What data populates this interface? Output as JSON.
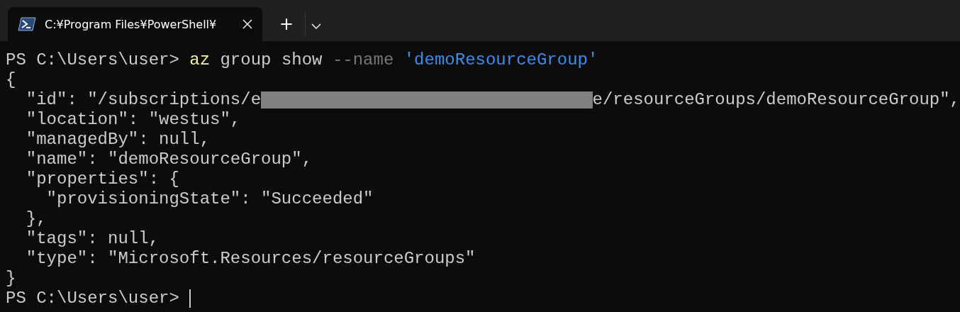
{
  "tabs": [
    {
      "title": "C:¥Program Files¥PowerShell¥",
      "selected": true
    }
  ],
  "new_tab": "+",
  "lines": [
    {
      "segments": [
        {
          "kind": "text",
          "text": "PS C:\\Users\\user> "
        },
        {
          "kind": "command",
          "text": "az"
        },
        {
          "kind": "text",
          "text": " group show "
        },
        {
          "kind": "parameter",
          "text": "--name"
        },
        {
          "kind": "string",
          "text": " 'demoResourceGroup'"
        }
      ]
    },
    {
      "segments": [
        {
          "kind": "text",
          "text": "{"
        }
      ]
    },
    {
      "segments": [
        {
          "kind": "text",
          "text": "  \"id\": \"/subscriptions/e"
        },
        {
          "kind": "redacted"
        },
        {
          "kind": "text",
          "text": "e/resourceGroups/demoResourceGroup\","
        }
      ]
    },
    {
      "segments": [
        {
          "kind": "text",
          "text": "  \"location\": \"westus\","
        }
      ]
    },
    {
      "segments": [
        {
          "kind": "text",
          "text": "  \"managedBy\": null,"
        }
      ]
    },
    {
      "segments": [
        {
          "kind": "text",
          "text": "  \"name\": \"demoResourceGroup\","
        }
      ]
    },
    {
      "segments": [
        {
          "kind": "text",
          "text": "  \"properties\": {"
        }
      ]
    },
    {
      "segments": [
        {
          "kind": "text",
          "text": "    \"provisioningState\": \"Succeeded\""
        }
      ]
    },
    {
      "segments": [
        {
          "kind": "text",
          "text": "  },"
        }
      ]
    },
    {
      "segments": [
        {
          "kind": "text",
          "text": "  \"tags\": null,"
        }
      ]
    },
    {
      "segments": [
        {
          "kind": "text",
          "text": "  \"type\": \"Microsoft.Resources/resourceGroups\""
        }
      ]
    },
    {
      "segments": [
        {
          "kind": "text",
          "text": "}"
        }
      ]
    },
    {
      "segments": [
        {
          "kind": "text",
          "text": "PS C:\\Users\\user> "
        },
        {
          "kind": "cursor"
        }
      ]
    }
  ]
}
